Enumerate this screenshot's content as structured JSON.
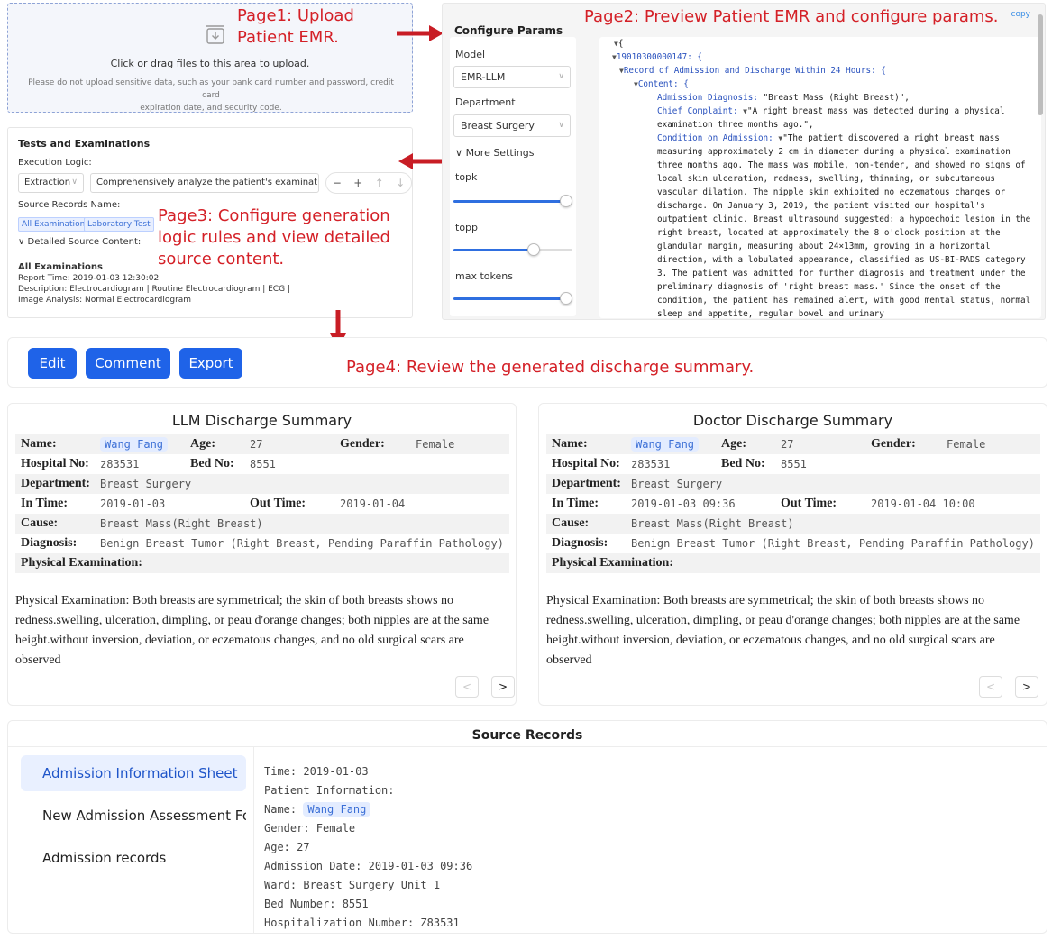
{
  "annotations": {
    "page1": [
      "Page1: Upload",
      "Patient EMR."
    ],
    "page2": "Page2:  Preview Patient EMR and configure params.",
    "page3": [
      "Page3: Configure generation",
      "logic rules and view detailed",
      "source content."
    ],
    "page4": "Page4: Review the generated discharge summary."
  },
  "upload": {
    "icon": "inbox-upload-icon",
    "main_text": "Click or drag files to this area to upload.",
    "hint_line1": "Please do not upload sensitive data, such as your bank card number and password, credit card",
    "hint_line2": "expiration date, and security code."
  },
  "tests": {
    "title": "Tests and Examinations",
    "execution_logic_label": "Execution Logic:",
    "mode": "Extraction",
    "logic_text": "Comprehensively analyze the patient's examination a",
    "controls": [
      "−",
      "+",
      "↑",
      "↓"
    ],
    "source_records_label": "Source Records Name:",
    "tags": [
      "All Examinations",
      "Laboratory Test"
    ],
    "detailed_toggle": "Detailed Source Content:",
    "record_title": "All Examinations",
    "record_lines": [
      "Report Time: 2019-01-03 12:30:02",
      "Description: Electrocardiogram | Routine Electrocardiogram | ECG |",
      "Image Analysis: Normal Electrocardiogram"
    ]
  },
  "config": {
    "title": "Configure Params",
    "model_label": "Model",
    "model_value": "EMR-LLM",
    "department_label": "Department",
    "department_value": "Breast Surgery",
    "more_settings": "More Settings",
    "sliders": [
      {
        "label": "topk",
        "value": 1.0
      },
      {
        "label": "topp",
        "value": 0.7
      },
      {
        "label": "max tokens",
        "value": 1.0
      }
    ],
    "copy_label": "copy"
  },
  "emr_json": {
    "root_open": "{",
    "record_id": "19010300000147: {",
    "record_title": "Record of Admission and Discharge Within 24 Hours: {",
    "content_key": "Content: {",
    "admission_diagnosis_key": "Admission Diagnosis:",
    "admission_diagnosis_value": "\"Breast Mass (Right Breast)\",",
    "chief_complaint_key": "Chief Complaint:",
    "chief_complaint_value": "\"A right breast mass was detected during a physical examination three months ago.\",",
    "condition_key": "Condition on Admission:",
    "condition_value": "\"The patient discovered a right breast mass measuring approximately 2 cm in diameter during a physical examination three months ago. The mass was mobile, non-tender, and showed no signs of local skin ulceration, redness, swelling, thinning, or subcutaneous vascular dilation. The nipple skin exhibited no eczematous changes or discharge. On January 3, 2019, the patient visited our hospital's outpatient clinic. Breast ultrasound suggested: a hypoechoic lesion in the right breast, located at approximately the 8 o'clock position at the glandular margin, measuring about 24×13mm, growing in a horizontal direction, with a lobulated appearance, classified as US-BI-RADS category 3. The patient was admitted for further diagnosis and treatment under the preliminary diagnosis of 'right breast mass.' Since the onset of the condition, the patient has remained alert, with good mental status, normal sleep and appetite, regular bowel and urinary"
  },
  "toolbar": {
    "edit": "Edit",
    "comment": "Comment",
    "export": "Export"
  },
  "llm_summary": {
    "title": "LLM Discharge Summary",
    "name_label": "Name:",
    "name": "Wang Fang",
    "age_label": "Age:",
    "age": "27",
    "gender_label": "Gender:",
    "gender": "Female",
    "hospital_no_label": "Hospital No:",
    "hospital_no": "z83531",
    "bed_no_label": "Bed No:",
    "bed_no": "8551",
    "department_label": "Department:",
    "department": "Breast Surgery",
    "in_time_label": "In Time:",
    "in_time": "2019-01-03",
    "out_time_label": "Out Time:",
    "out_time": "2019-01-04",
    "cause_label": "Cause:",
    "cause": "Breast Mass(Right Breast)",
    "diagnosis_label": "Diagnosis:",
    "diagnosis": "Benign Breast Tumor (Right Breast, Pending Paraffin Pathology)",
    "pe_label": "Physical Examination:",
    "pe_text": "Physical Examination: Both breasts are symmetrical; the skin of both breasts shows no redness.swelling, ulceration, dimpling, or peau d'orange changes; both nipples are at the same height.without inversion, deviation, or eczematous changes, and no old surgical scars are observed",
    "prev": "<",
    "next": ">"
  },
  "doctor_summary": {
    "title": "Doctor Discharge Summary",
    "name_label": "Name:",
    "name": "Wang Fang",
    "age_label": "Age:",
    "age": "27",
    "gender_label": "Gender:",
    "gender": "Female",
    "hospital_no_label": "Hospital No:",
    "hospital_no": "z83531",
    "bed_no_label": "Bed No:",
    "bed_no": "8551",
    "department_label": "Department:",
    "department": "Breast Surgery",
    "in_time_label": "In Time:",
    "in_time": "2019-01-03 09:36",
    "out_time_label": "Out Time:",
    "out_time": "2019-01-04 10:00",
    "cause_label": "Cause:",
    "cause": "Breast Mass(Right Breast)",
    "diagnosis_label": "Diagnosis:",
    "diagnosis": "Benign Breast Tumor (Right Breast, Pending Paraffin Pathology)",
    "pe_label": "Physical Examination:",
    "pe_text": "Physical Examination: Both breasts are symmetrical; the skin of both breasts shows no redness.swelling, ulceration, dimpling, or peau d'orange changes; both nipples are at the same height.without inversion, deviation, or eczematous changes, and no old surgical scars are observed",
    "prev": "<",
    "next": ">"
  },
  "source_records": {
    "title": "Source Records",
    "items": [
      "Admission Information Sheet",
      "New Admission Assessment Fo...",
      "Admission records"
    ],
    "active_index": 0,
    "time": "Time: 2019-01-03",
    "patient_info": "Patient Information:",
    "name_label": "Name:",
    "name": "Wang Fang",
    "gender": "Gender: Female",
    "age": "Age: 27",
    "admission_date": "Admission Date: 2019-01-03 09:36",
    "ward": "Ward: Breast Surgery Unit 1",
    "bed": "Bed Number: 8551",
    "hosp_no": "Hospitalization Number: Z83531"
  },
  "colors": {
    "annotation": "#d42027",
    "primary": "#1f63e8",
    "json_key": "#2a52be"
  }
}
